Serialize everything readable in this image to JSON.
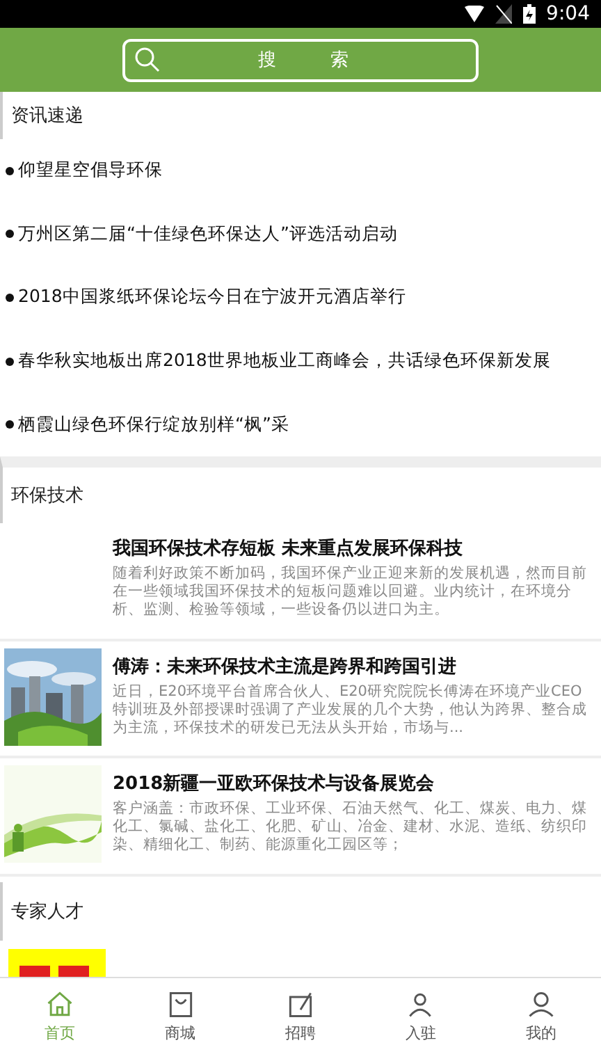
{
  "status_bar": {
    "time": "9:04"
  },
  "search": {
    "placeholder": "搜　　　索"
  },
  "news": {
    "title": "资讯速递",
    "items": [
      {
        "text": "仰望星空倡导环保"
      },
      {
        "text": "万州区第二届“十佳绿色环保达人”评选活动启动"
      },
      {
        "text": "2018中国浆纸环保论坛今日在宁波开元酒店举行"
      },
      {
        "text": "春华秋实地板出席2018世界地板业工商峰会，共话绿色环保新发展"
      },
      {
        "text": "栖霞山绿色环保行绽放别样“枫”采"
      }
    ]
  },
  "tech": {
    "title": "环保技术",
    "articles": [
      {
        "title": "我国环保技术存短板 未来重点发展环保科技",
        "summary": "随着利好政策不断加码，我国环保产业正迎来新的发展机遇，然而目前在一些领域我国环保技术的短板问题难以回避。业内统计，在环境分析、监测、检验等领域，一些设备仍以进口为主。"
      },
      {
        "title": "傅涛：未来环保技术主流是跨界和跨国引进",
        "summary": "近日，E20环境平台首席合伙人、E20研究院院长傅涛在环境产业CEO特训班及外部授课时强调了产业发展的几个大势，他认为跨界、整合成为主流，环保技术的研发已无法从头开始，市场与...",
        "kind": "picture"
      },
      {
        "title": "2018新疆一亚欧环保技术与设备展览会",
        "summary": "客户涵盖：市政环保、工业环保、石油天然气、化工、煤炭、电力、煤化工、氯碱、盐化工、化肥、矿山、冶金、建材、水泥、造纸、纺织印染、精细化工、制药、能源重化工园区等；",
        "kind": "picture"
      }
    ]
  },
  "experts": {
    "title": "专家人才"
  },
  "tabs": [
    {
      "label": "首页",
      "selected": true
    },
    {
      "label": "商城",
      "selected": false
    },
    {
      "label": "招聘",
      "selected": false
    },
    {
      "label": "入驻",
      "selected": false
    },
    {
      "label": "我的",
      "selected": false
    }
  ]
}
